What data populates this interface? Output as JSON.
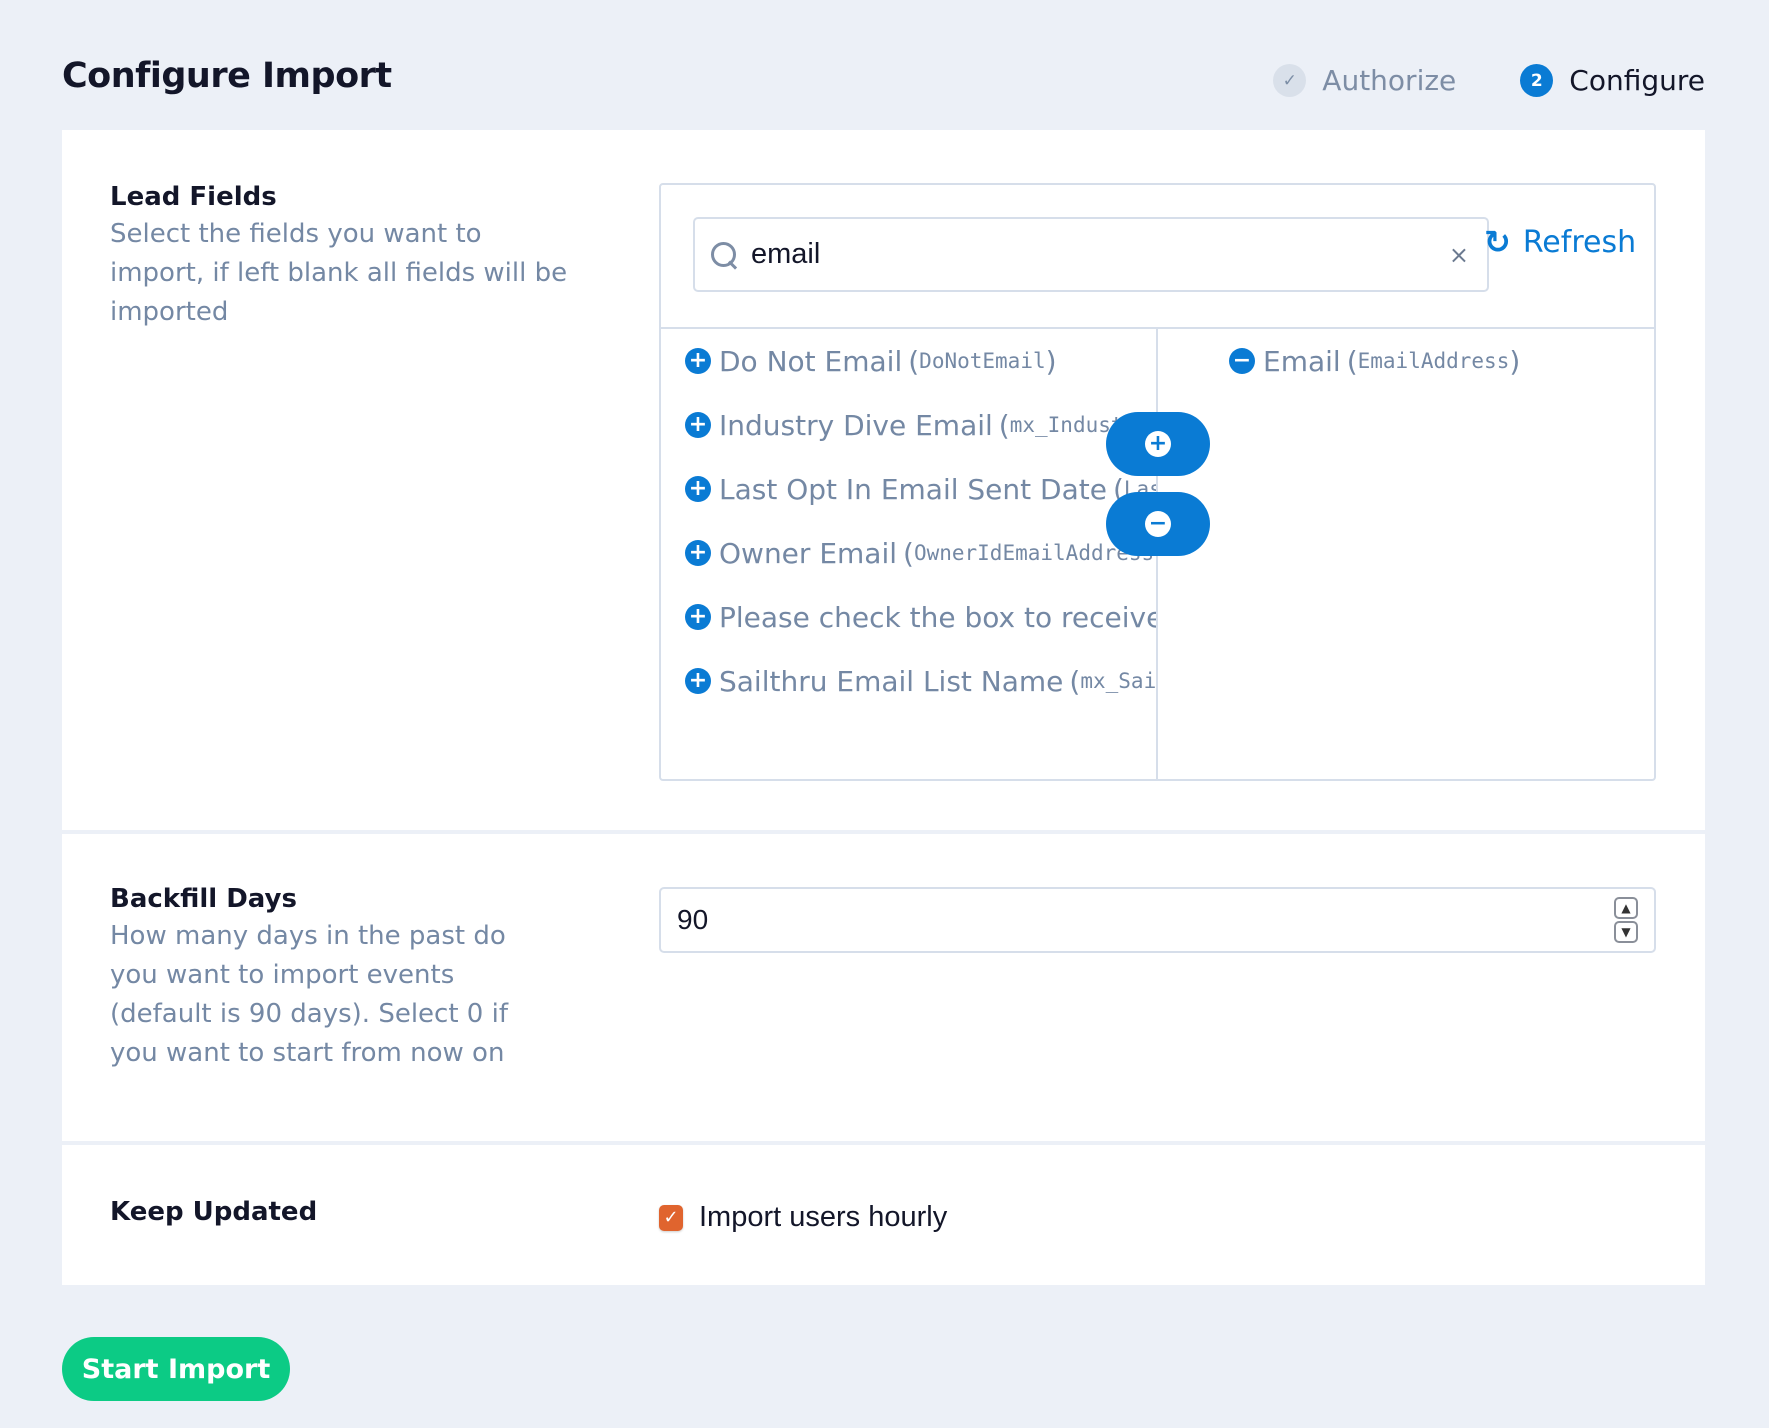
{
  "header": {
    "title": "Configure Import",
    "steps": [
      {
        "number": "✓",
        "label": "Authorize",
        "state": "done"
      },
      {
        "number": "2",
        "label": "Configure",
        "state": "active"
      }
    ]
  },
  "lead_fields": {
    "title": "Lead Fields",
    "description": "Select the fields you want to import, if left blank all fields will be imported",
    "search": {
      "value": "email",
      "placeholder": "",
      "clear_label": "×"
    },
    "refresh_label": "Refresh",
    "available": [
      {
        "name": "Do Not Email",
        "key": "DoNotEmail"
      },
      {
        "name": "Industry Dive Email",
        "key": "mx_Industr"
      },
      {
        "name": "Last Opt In Email Sent Date",
        "key": "LastOp"
      },
      {
        "name": "Owner Email",
        "key": "OwnerIdEmailAddress"
      },
      {
        "name": "Please check the box to receive occ",
        "key": ""
      },
      {
        "name": "Sailthru Email List Name",
        "key": "mx_Sailth"
      }
    ],
    "selected": [
      {
        "name": "Email",
        "key": "EmailAddress"
      }
    ],
    "add_icon": "+",
    "remove_icon": "−"
  },
  "backfill": {
    "title": "Backfill Days",
    "description": "How many days in the past do you want to import events (default is 90 days). Select 0 if you want to start from now on",
    "value": "90"
  },
  "keep_updated": {
    "title": "Keep Updated",
    "checkbox_label": "Import users hourly",
    "checked": true
  },
  "actions": {
    "start_label": "Start Import"
  },
  "colors": {
    "accent": "#0a7bd4",
    "success": "#0ccb85",
    "checkbox": "#e0642e",
    "background": "#ecf0f7"
  }
}
